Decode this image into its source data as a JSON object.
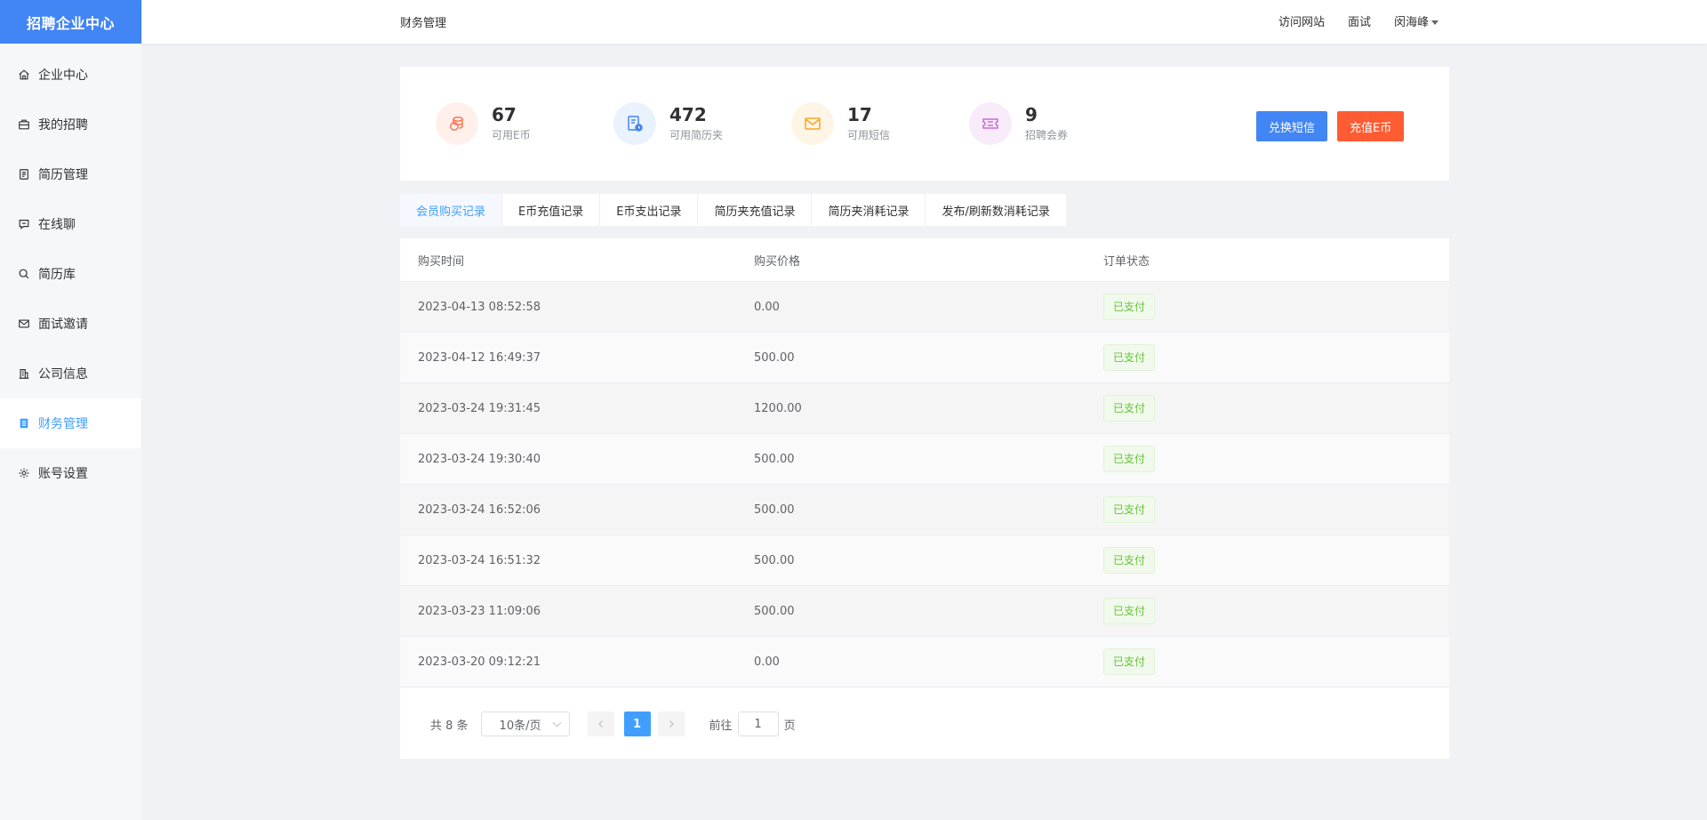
{
  "app": {
    "title": "招聘企业中心"
  },
  "sidebar": {
    "items": [
      {
        "label": "企业中心",
        "icon": "home-icon"
      },
      {
        "label": "我的招聘",
        "icon": "briefcase-icon"
      },
      {
        "label": "简历管理",
        "icon": "document-icon"
      },
      {
        "label": "在线聊",
        "icon": "chat-icon"
      },
      {
        "label": "简历库",
        "icon": "search-icon"
      },
      {
        "label": "面试邀请",
        "icon": "mail-icon"
      },
      {
        "label": "公司信息",
        "icon": "building-icon"
      },
      {
        "label": "财务管理",
        "icon": "finance-icon",
        "active": true
      },
      {
        "label": "账号设置",
        "icon": "gear-icon"
      }
    ]
  },
  "header": {
    "breadcrumb": "财务管理",
    "links": [
      "访问网站",
      "面试"
    ],
    "user": "闵海峰"
  },
  "stats": [
    {
      "value": "67",
      "label": "可用E币",
      "icon": "coins-icon",
      "color": "#ff7452",
      "bg": "#fff0ec"
    },
    {
      "value": "472",
      "label": "可用简历夹",
      "icon": "resume-folder-icon",
      "color": "#4285f4",
      "bg": "#eaf2fe"
    },
    {
      "value": "17",
      "label": "可用短信",
      "icon": "envelope-icon",
      "color": "#f5a623",
      "bg": "#fff5e6"
    },
    {
      "value": "9",
      "label": "招聘会券",
      "icon": "ticket-icon",
      "color": "#c86dd7",
      "bg": "#f8ecfa"
    }
  ],
  "actions": {
    "exchange_sms": "兑换短信",
    "recharge": "充值E币"
  },
  "tabs": [
    "会员购买记录",
    "E币充值记录",
    "E币支出记录",
    "简历夹充值记录",
    "简历夹消耗记录",
    "发布/刷新数消耗记录"
  ],
  "table": {
    "headers": [
      "购买时间",
      "购买价格",
      "订单状态"
    ],
    "rows": [
      {
        "time": "2023-04-13 08:52:58",
        "price": "0.00",
        "status": "已支付"
      },
      {
        "time": "2023-04-12 16:49:37",
        "price": "500.00",
        "status": "已支付"
      },
      {
        "time": "2023-03-24 19:31:45",
        "price": "1200.00",
        "status": "已支付"
      },
      {
        "time": "2023-03-24 19:30:40",
        "price": "500.00",
        "status": "已支付"
      },
      {
        "time": "2023-03-24 16:52:06",
        "price": "500.00",
        "status": "已支付"
      },
      {
        "time": "2023-03-24 16:51:32",
        "price": "500.00",
        "status": "已支付"
      },
      {
        "time": "2023-03-23 11:09:06",
        "price": "500.00",
        "status": "已支付"
      },
      {
        "time": "2023-03-20 09:12:21",
        "price": "0.00",
        "status": "已支付"
      }
    ]
  },
  "pagination": {
    "total_text": "共 8 条",
    "page_size": "10条/页",
    "current_page": "1",
    "goto_label": "前往",
    "goto_value": "1",
    "page_suffix": "页"
  }
}
